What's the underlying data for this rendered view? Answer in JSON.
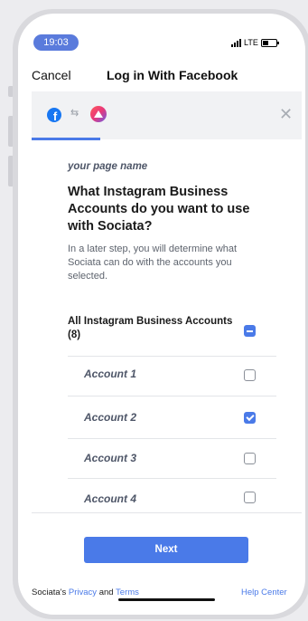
{
  "status_bar": {
    "time": "19:03",
    "network": "LTE"
  },
  "nav": {
    "cancel_label": "Cancel",
    "title": "Log in With Facebook"
  },
  "header_band": {
    "left_icons": [
      "facebook-icon",
      "swap-arrows-icon",
      "sociata-app-icon"
    ],
    "close_icon": "close-icon",
    "progress_color": "#4a7ae8"
  },
  "page_name": "your page name",
  "heading": "What Instagram Business Accounts do you want to use with Sociata?",
  "description": "In a later step, you will determine what Sociata can do with the accounts you selected.",
  "all_accounts": {
    "label": "All Instagram Business Accounts (8)",
    "state": "indeterminate"
  },
  "accounts": [
    {
      "name": "Account 1",
      "checked": false
    },
    {
      "name": "Account 2",
      "checked": true
    },
    {
      "name": "Account 3",
      "checked": false
    },
    {
      "name": "Account 4",
      "checked": false
    }
  ],
  "next_label": "Next",
  "footer": {
    "brand": "Sociata",
    "possessive": "'s",
    "privacy_label": "Privacy",
    "and_label": "and",
    "terms_label": "Terms",
    "help_label": "Help Center"
  },
  "colors": {
    "accent": "#4a7ae8",
    "time_pill": "#5a7bdc",
    "facebook": "#1877f2"
  }
}
